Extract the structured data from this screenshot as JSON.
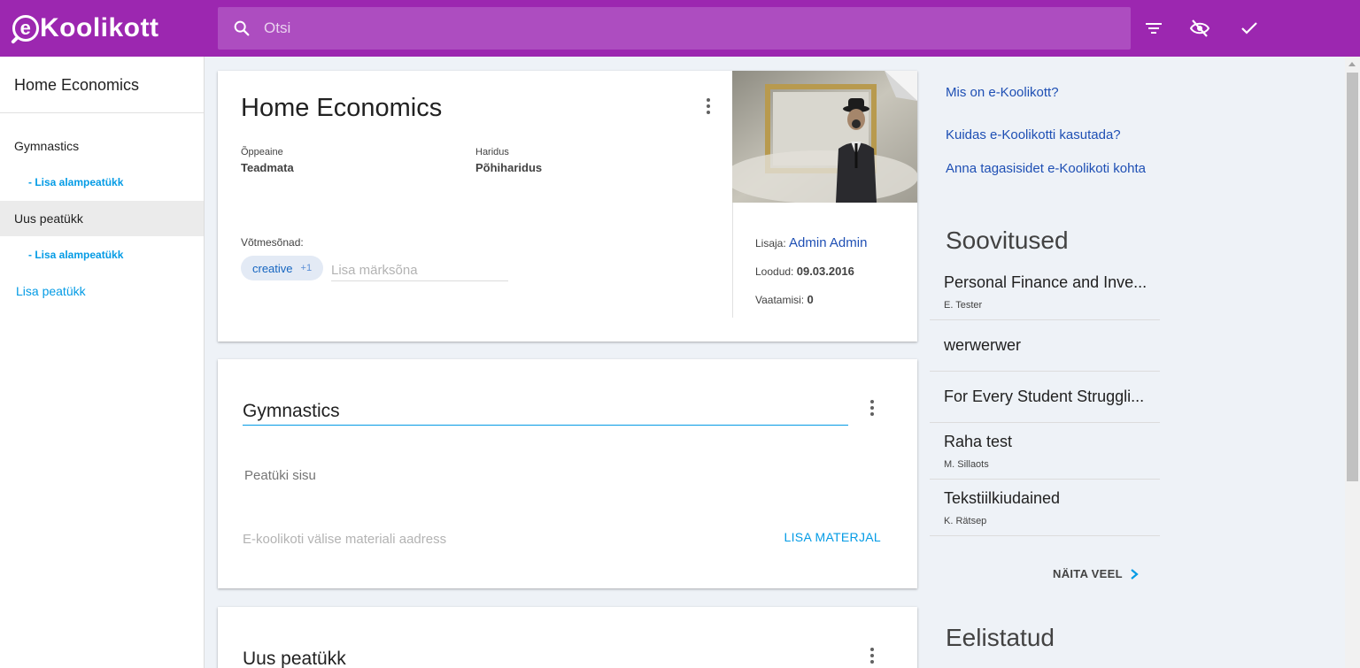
{
  "app": {
    "logo_text": "Koolikott"
  },
  "search": {
    "placeholder": "Otsi",
    "value": ""
  },
  "sidebar": {
    "title": "Home Economics",
    "chapters": [
      {
        "label": "Gymnastics",
        "add_sub": "- Lisa alampeatükk"
      },
      {
        "label": "Uus peatükk",
        "add_sub": "- Lisa alampeatükk"
      }
    ],
    "add_chapter": "Lisa peatükk"
  },
  "material": {
    "title": "Home Economics",
    "subject_label": "Õppeaine",
    "subject_value": "Teadmata",
    "education_label": "Haridus",
    "education_value": "Põhiharidus",
    "keywords_label": "Võtmesõnad:",
    "keyword": "creative",
    "keyword_count": "+1",
    "keyword_placeholder": "Lisa märksõna",
    "added_by_label": "Lisaja:",
    "added_by": "Admin Admin",
    "created_label": "Loodud:",
    "created": "09.03.2016",
    "views_label": "Vaatamisi:",
    "views": "0"
  },
  "chapters": [
    {
      "title": "Gymnastics",
      "body_placeholder": "Peatüki sisu",
      "url_placeholder": "E-koolikoti välise materiali aadress",
      "add_material": "LISA MATERJAL"
    },
    {
      "title": "Uus peatükk"
    }
  ],
  "right": {
    "links": [
      "Mis on e-Koolikott?",
      "Kuidas e-Koolikotti kasutada?",
      "Anna tagasisidet e-Koolikoti kohta"
    ],
    "recommendations_heading": "Soovitused",
    "recommendations": [
      {
        "title": "Personal Finance and Inve...",
        "author": "E. Tester"
      },
      {
        "title": "werwerwer",
        "author": ""
      },
      {
        "title": "For Every Student Struggli...",
        "author": ""
      },
      {
        "title": "Raha test",
        "author": "M. Sillaots"
      },
      {
        "title": "Tekstiilkiudained",
        "author": "K. Rätsep"
      }
    ],
    "show_more": "NÄITA VEEL",
    "featured_heading": "Eelistatud"
  },
  "colors": {
    "primary": "#9c27b0",
    "accent": "#039be5",
    "link": "#1e4fb4"
  },
  "icons": [
    "search-icon",
    "filter-icon",
    "visibility-off-icon",
    "check-icon",
    "more-vert-icon",
    "chevron-right-icon"
  ]
}
